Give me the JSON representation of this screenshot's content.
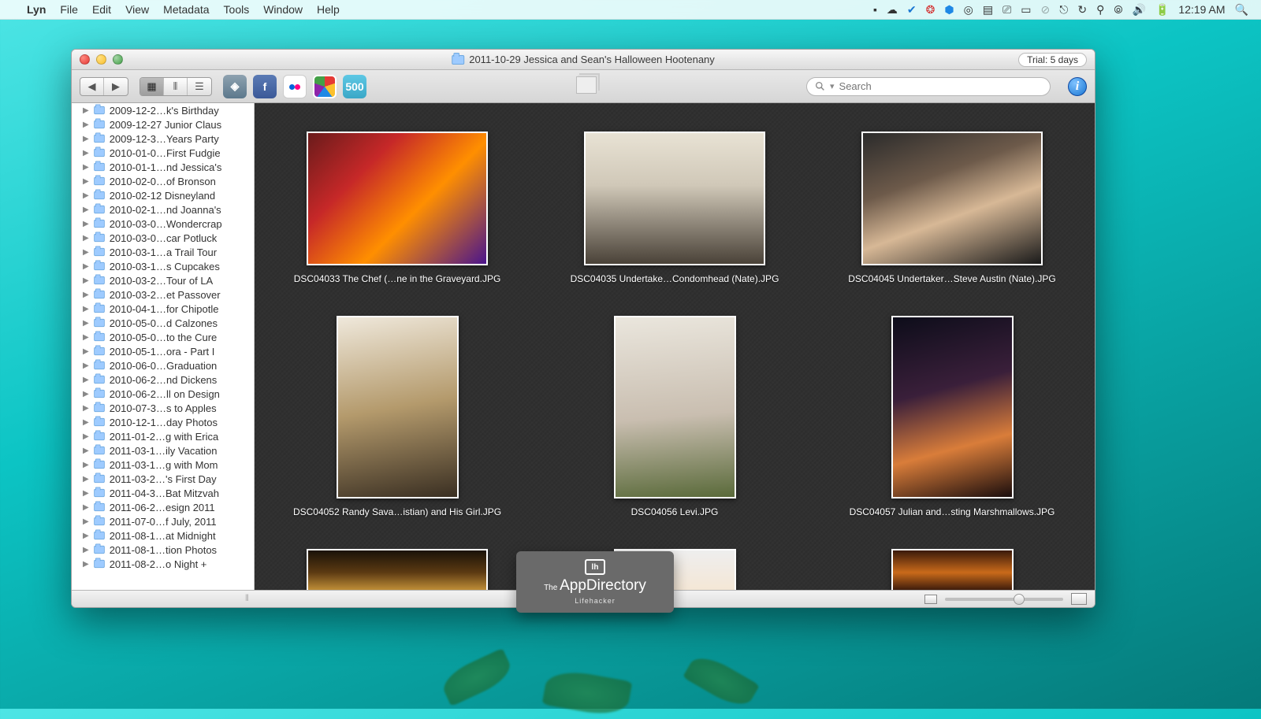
{
  "menubar": {
    "apple": "",
    "app": "Lyn",
    "items": [
      "File",
      "Edit",
      "View",
      "Metadata",
      "Tools",
      "Window",
      "Help"
    ],
    "clock": "12:19 AM"
  },
  "window": {
    "title": "2011-10-29 Jessica and Sean's Halloween Hootenany",
    "trial": "Trial: 5 days",
    "search_placeholder": "Search"
  },
  "sidebar": [
    "2009-12-2…k's Birthday",
    "2009-12-27 Junior Claus",
    "2009-12-3…Years Party",
    "2010-01-0…First Fudgie",
    "2010-01-1…nd Jessica's",
    "2010-02-0…of Bronson",
    "2010-02-12 Disneyland",
    "2010-02-1…nd Joanna's",
    "2010-03-0…Wondercrap",
    "2010-03-0…car Potluck",
    "2010-03-1…a Trail Tour",
    "2010-03-1…s Cupcakes",
    "2010-03-2…Tour of LA",
    "2010-03-2…et Passover",
    "2010-04-1…for Chipotle",
    "2010-05-0…d Calzones",
    "2010-05-0…to the Cure",
    "2010-05-1…ora - Part I",
    "2010-06-0…Graduation",
    "2010-06-2…nd Dickens",
    "2010-06-2…ll on Design",
    "2010-07-3…s to Apples",
    "2010-12-1…day Photos",
    "2011-01-2…g with Erica",
    "2011-03-1…ily Vacation",
    "2011-03-1…g with Mom",
    "2011-03-2…'s First Day",
    "2011-04-3…Bat Mitzvah",
    "2011-06-2…esign 2011",
    "2011-07-0…f July, 2011",
    "2011-08-1…at Midnight",
    "2011-08-1…tion Photos",
    "2011-08-2…o Night +"
  ],
  "thumbs": [
    {
      "caption": "DSC04033 The Chef (…ne in the Graveyard.JPG",
      "shape": "landscape",
      "bg": "linear-gradient(135deg,#6a1b1b 0%,#c62828 30%,#ff8f00 60%,#4a148c 100%)"
    },
    {
      "caption": "DSC04035 Undertake…Condomhead (Nate).JPG",
      "shape": "landscape",
      "bg": "linear-gradient(180deg,#e8e2d4 0%,#d0c8b8 40%,#4a4238 100%)"
    },
    {
      "caption": "DSC04045 Undertaker…Steve Austin (Nate).JPG",
      "shape": "landscape",
      "bg": "linear-gradient(160deg,#2b2b2b 0%,#6d5a4a 35%,#d7b896 60%,#1a1a1a 100%)"
    },
    {
      "caption": "DSC04052 Randy Sava…istian) and His Girl.JPG",
      "shape": "portrait",
      "bg": "linear-gradient(170deg,#efe8db 0%,#b49a6c 50%,#3a2f22 100%)"
    },
    {
      "caption": "DSC04056 Levi.JPG",
      "shape": "portrait",
      "bg": "linear-gradient(175deg,#eae6dd 0%,#c9beb0 55%,#5a6a3a 100%)"
    },
    {
      "caption": "DSC04057 Julian and…sting Marshmallows.JPG",
      "shape": "portrait",
      "bg": "linear-gradient(165deg,#0d0d1a 0%,#3a1f3a 40%,#d97d3a 70%,#1a0d0d 100%)"
    }
  ],
  "badge": {
    "line1_pre": "The ",
    "line1_main": "AppDirectory",
    "line2": "Lifehacker",
    "icon": "lh"
  }
}
